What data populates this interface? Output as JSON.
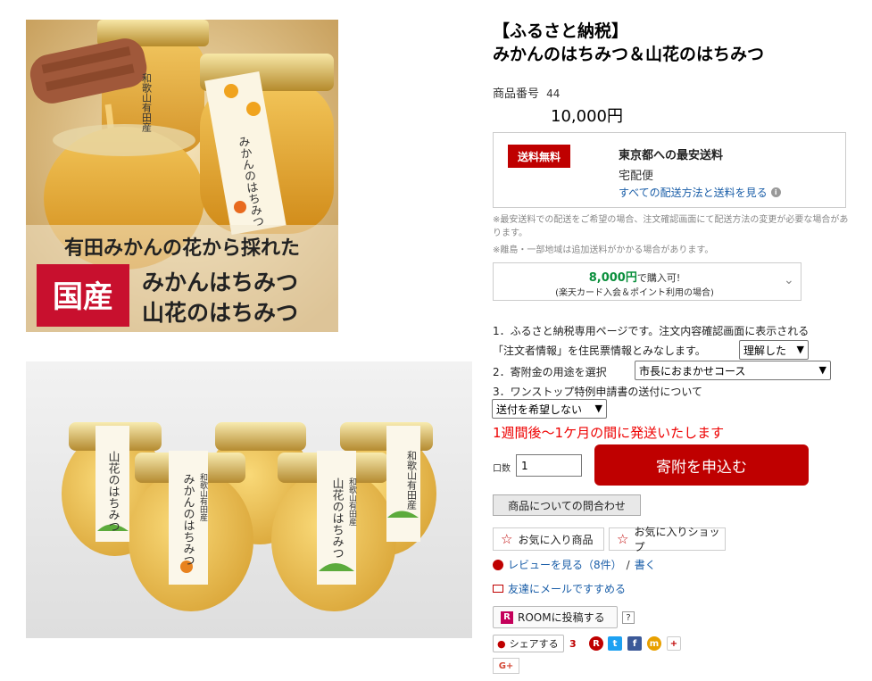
{
  "images": {
    "top": {
      "caption_line": "有田みかんの花から採れた",
      "badge": "国産",
      "products_line1": "みかんはちみつ",
      "products_line2": "山花のはちみつ",
      "jar_label_left": "和歌山有田産",
      "jar_label_main": "みかんのはちみつ"
    },
    "bottom": {
      "jar_labels": [
        "山花のはちみつ",
        "和歌山有田産",
        "みかんのはちみつ",
        "和歌山有田産",
        "山花のはちみつ",
        "和歌山有田産"
      ]
    }
  },
  "product": {
    "title_line1": "【ふるさと納税】",
    "title_line2": "みかんのはちみつ＆山花のはちみつ",
    "number_label": "商品番号",
    "number": "44",
    "price": "10,000円"
  },
  "shipping": {
    "badge": "送料無料",
    "cheapest_label": "東京都への最安送料",
    "method": "宅配便",
    "all_methods_link": "すべての配送方法と送料を見る",
    "info_icon": "i",
    "note1": "※最安送料での配送をご希望の場合、注文確認画面にて配送方法の変更が必要な場合があります。",
    "note2": "※離島・一部地域は追加送料がかかる場合があります。"
  },
  "card_offer": {
    "amount": "8,000円",
    "suffix": "で購入可!",
    "sub": "(楽天カード入会＆ポイント利用の場合)"
  },
  "options": {
    "item1_line1": "1．ふるさと納税専用ページです。注文内容確認画面に表示される",
    "item1_line2": "「注文者情報」を住民票情報とみなします。",
    "item1_select": "理解した",
    "item2_label": "2．寄附金の用途を選択",
    "item2_select": "市長におまかせコース",
    "item3_label": "3．ワンストップ特例申請書の送付について",
    "item3_select": "送付を希望しない"
  },
  "shipping_time": "1週間後～1ケ月の間に発送いたします",
  "purchase": {
    "qty_label": "口数",
    "qty_value": "1",
    "donate_button": "寄附を申込む"
  },
  "actions": {
    "inquiry": "商品についての問合わせ",
    "fav_item": "お気に入り商品",
    "fav_shop": "お気に入りショップ",
    "review_link": "レビューを見る（8件）",
    "review_sep": "/",
    "review_write": "書く",
    "mail_link": "友達にメールですすめる",
    "room": "ROOMに投稿する",
    "room_icon": "R",
    "help": "?",
    "share": "シェアする",
    "share_count": "3",
    "gplus": "G+"
  },
  "colors": {
    "brand_red": "#bf0000",
    "link_blue": "#1a5ea8",
    "card_green": "#0a8f3c",
    "notice_red": "#ee0000"
  }
}
